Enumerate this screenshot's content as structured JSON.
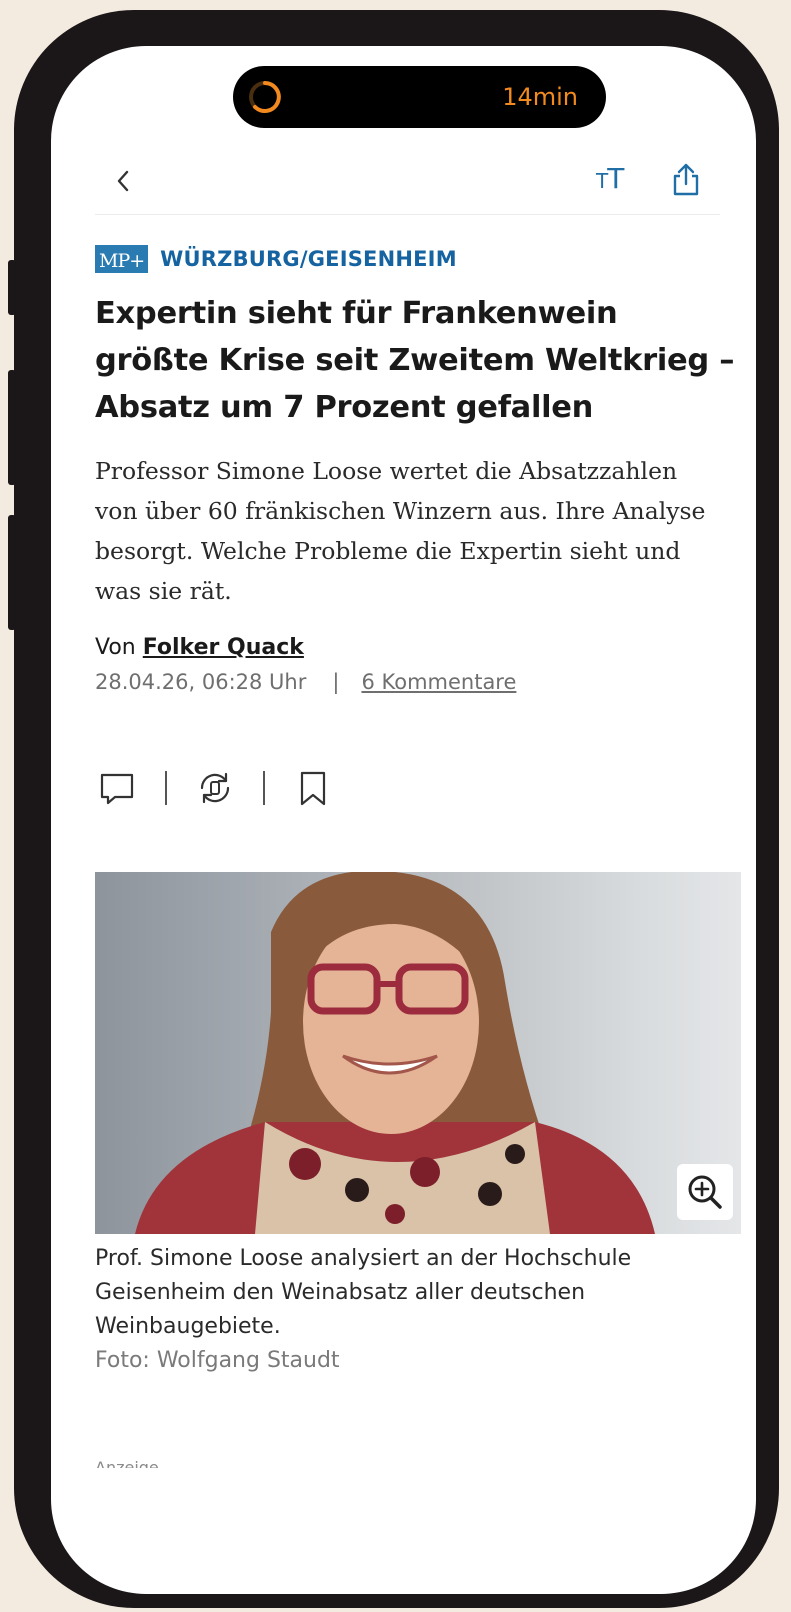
{
  "status": {
    "timer": "14min"
  },
  "toolbar": {
    "text_size_small": "T",
    "text_size_big": "T"
  },
  "article": {
    "badge": "MP+",
    "kicker": "WÜRZBURG/GEISENHEIM",
    "headline": "Expertin sieht für Frankenwein größte Krise seit Zweitem Weltkrieg – Absatz um 7 Prozent gefallen",
    "teaser": "Professor Simone Loose wertet die Absatzzahlen von über 60 fränkischen Winzern aus. Ihre Analyse besorgt. Welche Probleme die Expertin sieht und was sie rät.",
    "byline_prefix": "Von",
    "author": "Folker Quack",
    "date": "28.04.26, 06:28 Uhr",
    "separator": "|",
    "comments": "6 Kommentare"
  },
  "image": {
    "caption": "Prof. Simone Loose analysiert an der Hochschule Geisenheim den Weinabsatz aller deutschen Weinbaugebiete.",
    "credit": "Foto: Wolfgang Staudt"
  },
  "ad": {
    "label": "Anzeige"
  },
  "colors": {
    "accent": "#1663a1",
    "timer": "#f28a20",
    "badge": "#2b7bb3"
  }
}
